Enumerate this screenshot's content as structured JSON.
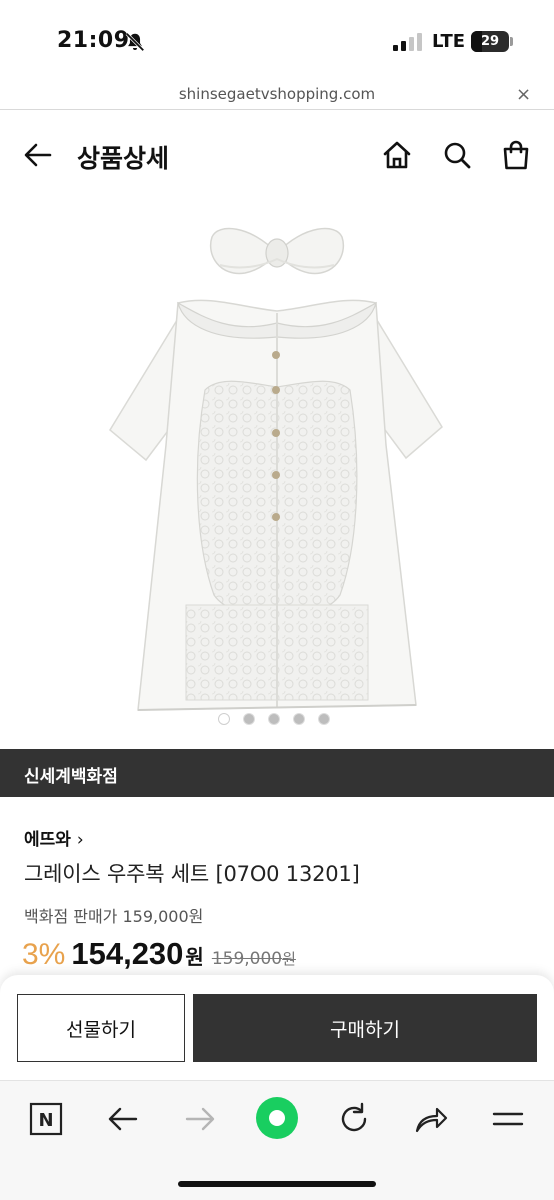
{
  "status_bar": {
    "time": "21:09",
    "network": "LTE",
    "battery": "29",
    "battery_level": 0.29
  },
  "url_bar": {
    "url": "shinsegaetvshopping.com",
    "close_label": "×"
  },
  "header": {
    "title": "상품상세"
  },
  "carousel": {
    "total": 5,
    "active_index": 0
  },
  "store": {
    "name": "신세계백화점"
  },
  "product": {
    "brand": "에뜨와",
    "brand_chevron": "›",
    "name": "그레이스 우주복 세트 [07O0 13201]",
    "dept_price_label": "백화점 판매가 159,000원",
    "discount": "3%",
    "sale_price": "154,230",
    "sale_currency": "원",
    "original_price": "159,000",
    "original_currency": "원"
  },
  "actions": {
    "gift_label": "선물하기",
    "buy_label": "구매하기"
  },
  "toolbar": {
    "n_label": "N"
  },
  "colors": {
    "accent_discount": "#e8a24d",
    "dark": "#333333",
    "green_button": "#19ce60"
  }
}
